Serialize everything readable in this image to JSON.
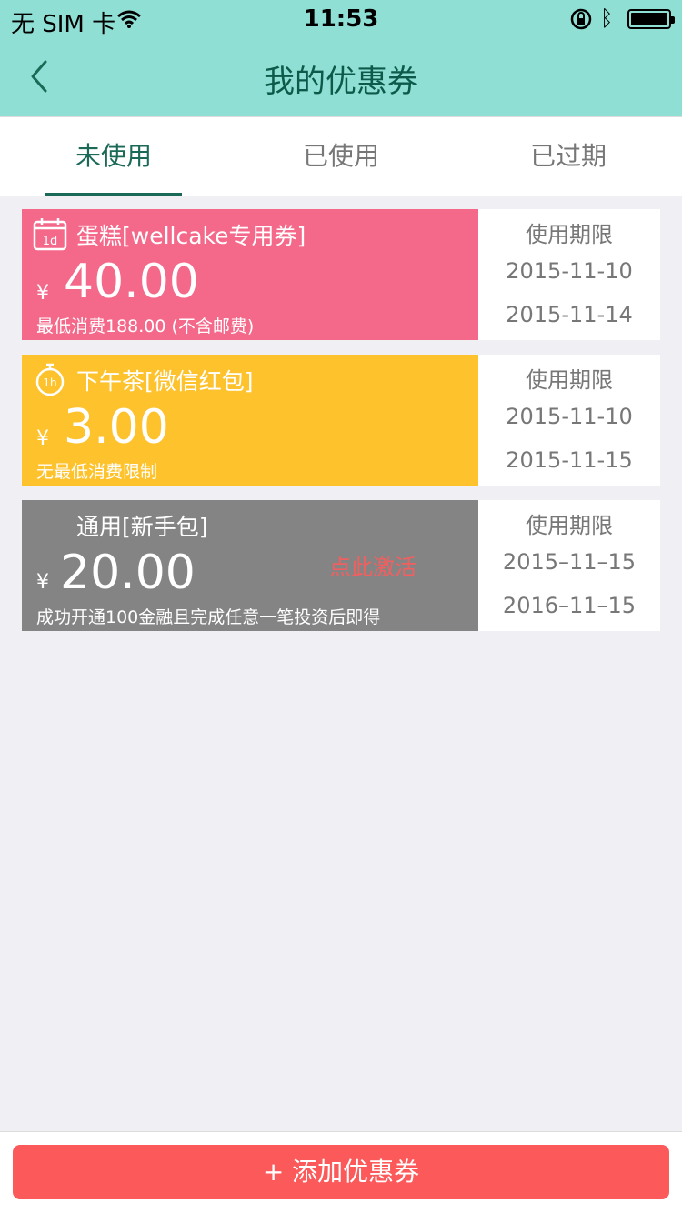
{
  "status_bar": {
    "carrier": "无 SIM 卡",
    "time": "11:53"
  },
  "nav": {
    "title": "我的优惠券"
  },
  "tabs": [
    {
      "label": "未使用",
      "active": true
    },
    {
      "label": "已使用",
      "active": false
    },
    {
      "label": "已过期",
      "active": false
    }
  ],
  "coupons": [
    {
      "name": "蛋糕[wellcake专用券]",
      "currency": "¥",
      "amount": "40.00",
      "condition": "最低消费188.00 (不含邮费)",
      "period_label": "使用期限",
      "start": "2015-11-10",
      "end": "2015-11-14",
      "color": "#f4688a",
      "icon": "calendar-icon"
    },
    {
      "name": "下午茶[微信红包]",
      "currency": "¥",
      "amount": "3.00",
      "condition": "无最低消费限制",
      "period_label": "使用期限",
      "start": "2015-11-10",
      "end": "2015-11-15",
      "color": "#fec22d",
      "icon": "stopwatch-icon"
    },
    {
      "name": "通用[新手包]",
      "currency": "¥",
      "amount": "20.00",
      "condition": "成功开通100金融且完成任意一笔投资后即得",
      "activate": "点此激活",
      "period_label": "使用期限",
      "start": "2015–11–15",
      "end": "2016–11–15",
      "color": "#848484"
    }
  ],
  "add_button": {
    "label": "+ 添加优惠券"
  }
}
